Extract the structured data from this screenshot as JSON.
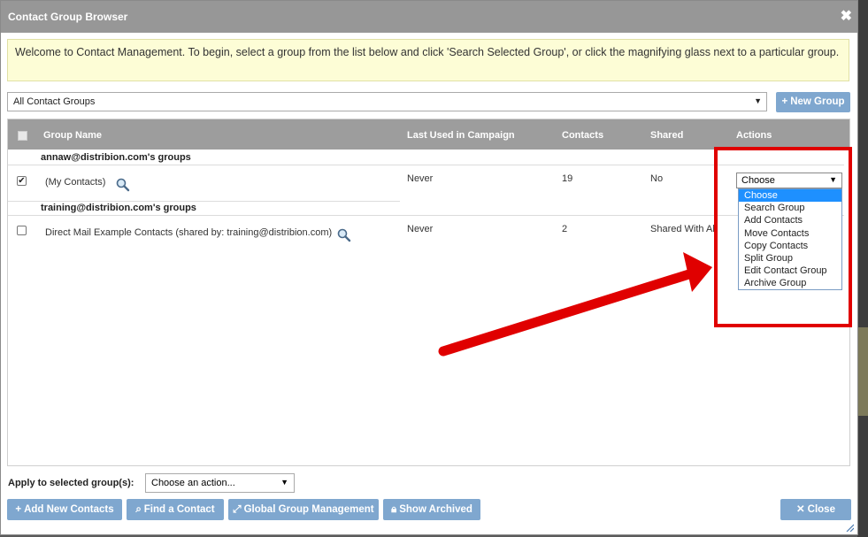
{
  "dialog": {
    "title": "Contact Group Browser",
    "close_glyph": "✖",
    "welcome_text": "Welcome to Contact Management. To begin, select a group from the list below and click 'Search Selected Group', or click the magnifying glass next to a particular group."
  },
  "toolbar": {
    "group_filter_value": "All Contact Groups",
    "new_group_label": "New Group"
  },
  "table": {
    "columns": [
      "Group Name",
      "Last Used in Campaign",
      "Contacts",
      "Shared",
      "Actions"
    ],
    "sections": [
      {
        "heading": "annaw@distribion.com's groups",
        "rows": [
          {
            "checked": true,
            "name": "(My Contacts)",
            "last_used": "Never",
            "contacts": "19",
            "shared": "No"
          }
        ]
      },
      {
        "heading": "training@distribion.com's groups",
        "rows": [
          {
            "checked": false,
            "name": "Direct Mail Example Contacts (shared by: training@distribion.com)",
            "last_used": "Never",
            "contacts": "2",
            "shared": "Shared With All"
          }
        ]
      }
    ]
  },
  "actions_dropdown": {
    "value": "Choose",
    "options": [
      "Choose",
      "Search Group",
      "Add Contacts",
      "Move Contacts",
      "Copy Contacts",
      "Split Group",
      "Edit Contact Group",
      "Archive Group"
    ],
    "highlighted": "Choose"
  },
  "footer": {
    "apply_label": "Apply to selected group(s):",
    "apply_select_value": "Choose an action...",
    "buttons": {
      "add_new_contacts": "Add New Contacts",
      "find_a_contact": "Find a Contact",
      "global_group_management": "Global Group Management",
      "show_archived": "Show Archived",
      "close": "Close"
    }
  },
  "colors": {
    "titlebar": "#979797",
    "button": "#7fa7cf",
    "welcome_bg": "#fdfdd6",
    "annotation_red": "#e00000",
    "menu_highlight": "#1e90ff"
  },
  "icons": {
    "magnifier": "search-icon",
    "plus": "plus-icon",
    "caret": "chevron-down-icon",
    "lock": "lock-icon",
    "expand": "expand-icon"
  }
}
